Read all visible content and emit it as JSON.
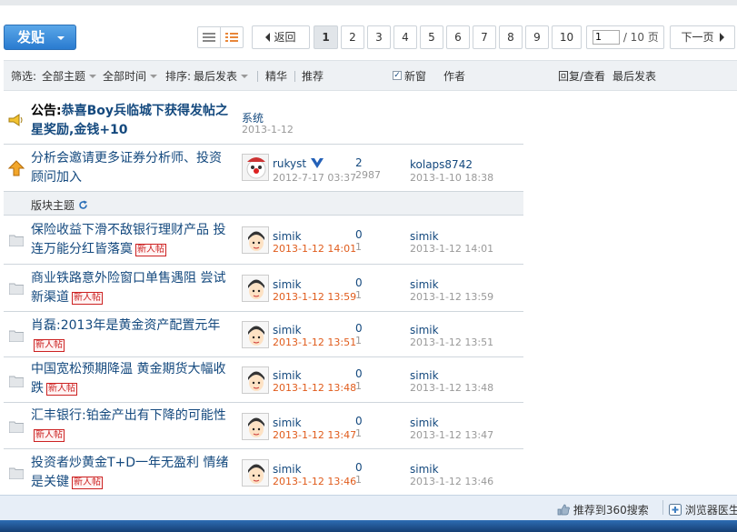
{
  "toolbar": {
    "post_label": "发贴",
    "back_label": "返回",
    "pages": [
      "1",
      "2",
      "3",
      "4",
      "5",
      "6",
      "7",
      "8",
      "9",
      "10"
    ],
    "current_page": "1",
    "jump_value": "1",
    "jump_total": "/ 10 页",
    "next_label": "下一页"
  },
  "filter": {
    "label": "筛选:",
    "all_topics": "全部主题",
    "all_time": "全部时间",
    "sort_label": "排序:",
    "sort_value": "最后发表",
    "digest": "精华",
    "recommend": "推荐",
    "new_window": "新窗",
    "new_window_checked": true,
    "author_col": "作者",
    "reply_col": "回复/查看",
    "last_col": "最后发表"
  },
  "announcement": {
    "prefix": "公告:",
    "title": "恭喜Boy兵临城下获得发帖之星奖励,金钱+10",
    "author": "系统",
    "date": "2013-1-12"
  },
  "sticky": {
    "title": "分析会邀请更多证券分析师、投资顾问加入",
    "author": "rukyst",
    "date": "2012-7-17 03:37",
    "replies": "2",
    "views": "2987",
    "last_author": "kolaps8742",
    "last_date": "2013-1-10 18:38"
  },
  "section": {
    "label": "版块主题"
  },
  "badge_new": "新人帖",
  "threads": [
    {
      "title": "保险收益下滑不敌银行理财产品 投连万能分红皆落寞",
      "author": "simik",
      "date": "2013-1-12 14:01",
      "replies": "0",
      "views": "1",
      "last_author": "simik",
      "last_date": "2013-1-12 14:01"
    },
    {
      "title": "商业铁路意外险窗口单售遇阻 尝试新渠道",
      "author": "simik",
      "date": "2013-1-12 13:59",
      "replies": "0",
      "views": "1",
      "last_author": "simik",
      "last_date": "2013-1-12 13:59"
    },
    {
      "title": "肖磊:2013年是黄金资产配置元年",
      "author": "simik",
      "date": "2013-1-12 13:51",
      "replies": "0",
      "views": "1",
      "last_author": "simik",
      "last_date": "2013-1-12 13:51"
    },
    {
      "title": "中国宽松预期降温 黄金期货大幅收跌",
      "author": "simik",
      "date": "2013-1-12 13:48",
      "replies": "0",
      "views": "1",
      "last_author": "simik",
      "last_date": "2013-1-12 13:48"
    },
    {
      "title": "汇丰银行:铂金产出有下降的可能性",
      "author": "simik",
      "date": "2013-1-12 13:47",
      "replies": "0",
      "views": "1",
      "last_author": "simik",
      "last_date": "2013-1-12 13:47"
    },
    {
      "title": "投资者炒黄金T+D一年无盈利 情绪是关键",
      "author": "simik",
      "date": "2013-1-12 13:46",
      "replies": "0",
      "views": "1",
      "last_author": "simik",
      "last_date": "2013-1-12 13:46"
    }
  ],
  "statusbar": {
    "recommend_360": "推荐到360搜索",
    "browser_doctor": "浏览器医生"
  },
  "colors": {
    "link": "#14497e",
    "accent_button": "#2a7bd0",
    "new_badge": "#cc2222",
    "hot_date": "#e05c1c"
  }
}
